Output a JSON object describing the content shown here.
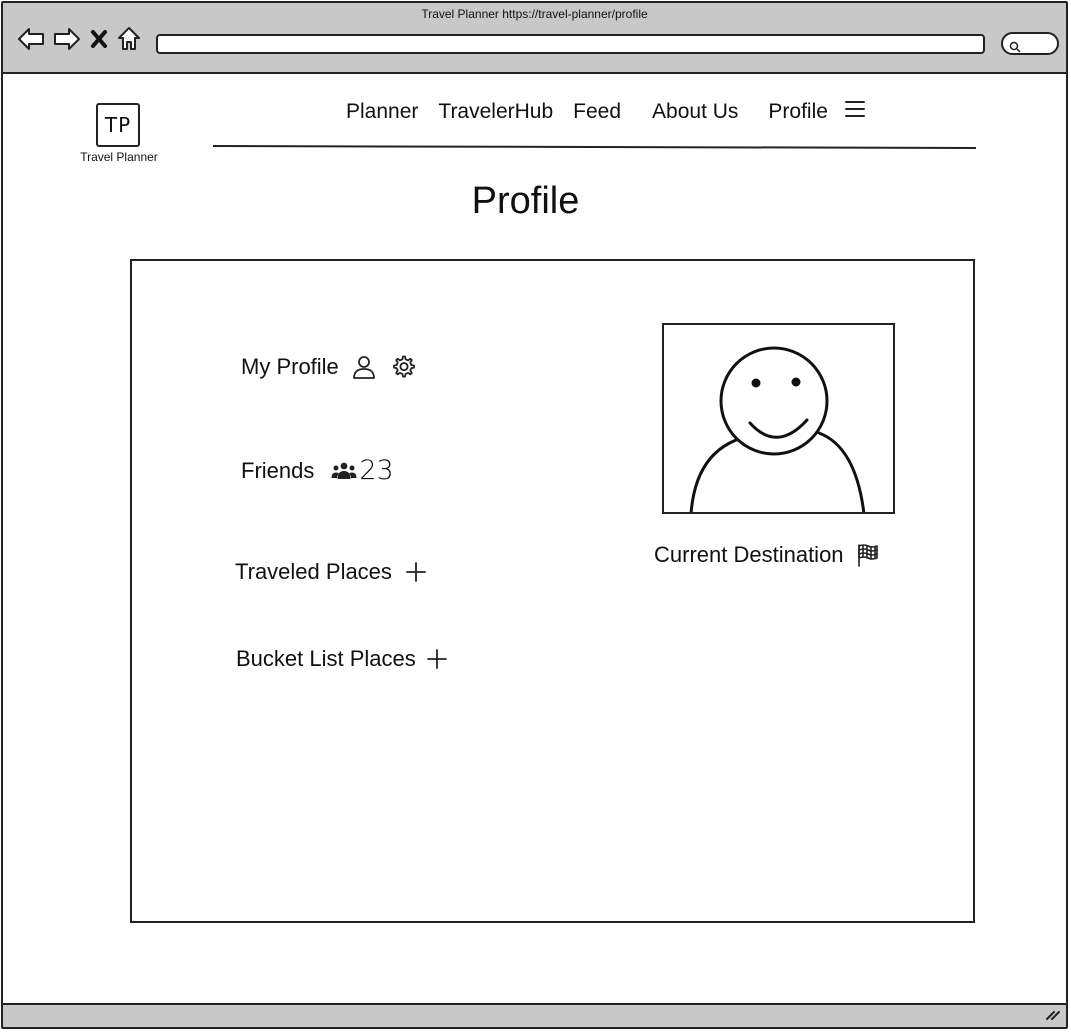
{
  "window": {
    "title": "Travel Planner https://travel-planner/profile",
    "address": ""
  },
  "browser_icons": [
    "back-icon",
    "forward-icon",
    "close-icon",
    "home-icon"
  ],
  "logo": {
    "mark": "TP",
    "caption": "Travel Planner"
  },
  "nav": {
    "items": [
      {
        "label": "Planner"
      },
      {
        "label": "TravelerHub"
      },
      {
        "label": "Feed"
      },
      {
        "label": "About Us"
      },
      {
        "label": "Profile"
      }
    ],
    "menu_icon": "hamburger-menu-icon"
  },
  "page": {
    "title": "Profile"
  },
  "profile": {
    "my_profile_label": "My Profile",
    "friends_label": "Friends",
    "friends_count": "23",
    "traveled_label": "Traveled Places",
    "bucket_label": "Bucket List Places",
    "current_destination_label": "Current Destination"
  },
  "icons": {
    "my_profile": [
      "user-icon",
      "gear-icon"
    ],
    "friends": "group-icon",
    "traveled_add": "plus-icon",
    "bucket_add": "plus-icon",
    "destination": "flag-icon",
    "avatar": "avatar-placeholder"
  }
}
